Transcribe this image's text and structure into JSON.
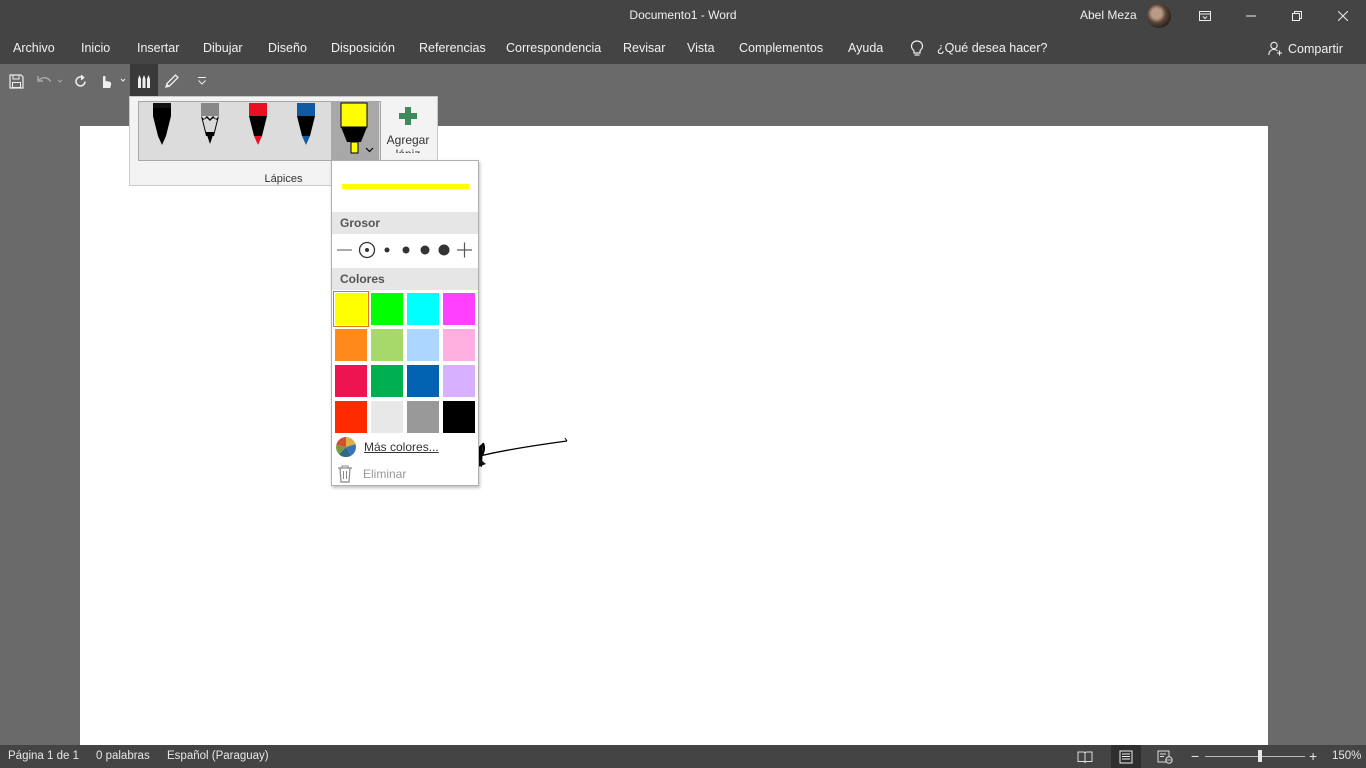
{
  "window": {
    "title": "Documento1  -  Word",
    "user_name": "Abel Meza"
  },
  "menu": {
    "items": [
      "Archivo",
      "Inicio",
      "Insertar",
      "Dibujar",
      "Diseño",
      "Disposición",
      "Referencias",
      "Correspondencia",
      "Revisar",
      "Vista",
      "Complementos",
      "Ayuda"
    ],
    "tell_me": "¿Qué desea hacer?",
    "share": "Compartir"
  },
  "pens_gallery": {
    "pens": [
      {
        "type": "pen",
        "color": "#000000"
      },
      {
        "type": "pencil",
        "color": "#888888"
      },
      {
        "type": "pen",
        "color": "#e81123"
      },
      {
        "type": "pen",
        "color": "#0f5aa0"
      },
      {
        "type": "highlighter",
        "color": "#ffff00",
        "selected": true
      }
    ],
    "add_pen_label": "Agregar lápiz",
    "group_label": "Lápices"
  },
  "pen_dropdown": {
    "preview_color": "#ffff00",
    "thickness_header": "Grosor",
    "colors_header": "Colores",
    "colors": [
      [
        "#ffff00",
        "#00ff00",
        "#00ffff",
        "#ff40ff"
      ],
      [
        "#ff8a1c",
        "#a6d86a",
        "#acd6ff",
        "#ffaee0"
      ],
      [
        "#ee1452",
        "#00b050",
        "#0062b1",
        "#d7b0ff"
      ],
      [
        "#ff2a00",
        "#e8e8e8",
        "#999999",
        "#000000"
      ]
    ],
    "selected_color": "#ffff00",
    "more_colors": "Más colores...",
    "erase": "Eliminar"
  },
  "status": {
    "page": "Página 1 de 1",
    "words": "0 palabras",
    "language": "Español (Paraguay)",
    "zoom": "150%",
    "zoom_level_percent": 150
  }
}
